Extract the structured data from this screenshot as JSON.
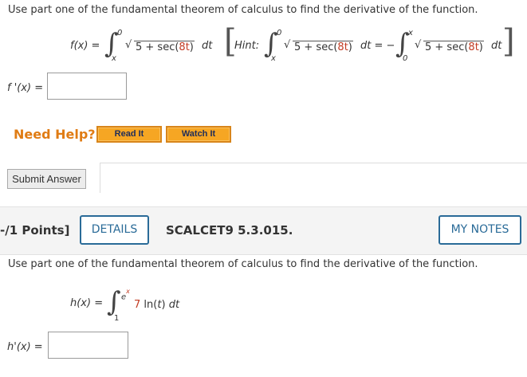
{
  "question1": {
    "prompt": "Use part one of the fundamental theorem of calculus to find the derivative of the function.",
    "function_lhs": "f(x) =",
    "integrand": "5 + sec(8t)",
    "integrand_prefix": "5 + sec(",
    "integrand_arg": "8t",
    "integrand_suffix": ")",
    "dt": "dt",
    "upper_limit": "0",
    "lower_limit": "x",
    "hint_label": "Hint:",
    "hint_equals": "dt = −",
    "hint_upper_limit": "x",
    "hint_lower_limit": "0",
    "answer_label": "f '(x) =",
    "answer_value": ""
  },
  "help": {
    "label": "Need Help?",
    "read_it": "Read It",
    "watch_it": "Watch It"
  },
  "submit": {
    "label": "Submit Answer"
  },
  "question2_header": {
    "points": "-/1 Points]",
    "details": "DETAILS",
    "code": "SCALCET9 5.3.015.",
    "my_notes": "MY NOTES"
  },
  "question2": {
    "prompt": "Use part one of the fundamental theorem of calculus to find the derivative of the function.",
    "function_lhs": "h(x) =",
    "upper_limit_base": "e",
    "upper_limit_exp": "x",
    "lower_limit": "1",
    "integrand_coef": "7",
    "integrand_ln": "ln(",
    "integrand_var": "t",
    "integrand_close": ")",
    "dt": "dt",
    "answer_label": "h'(x) =",
    "answer_value": ""
  },
  "colors": {
    "accent_blue": "#2a6b98",
    "help_orange": "#e07c14",
    "button_orange": "#f6a623",
    "highlight_red": "#c23b22"
  }
}
